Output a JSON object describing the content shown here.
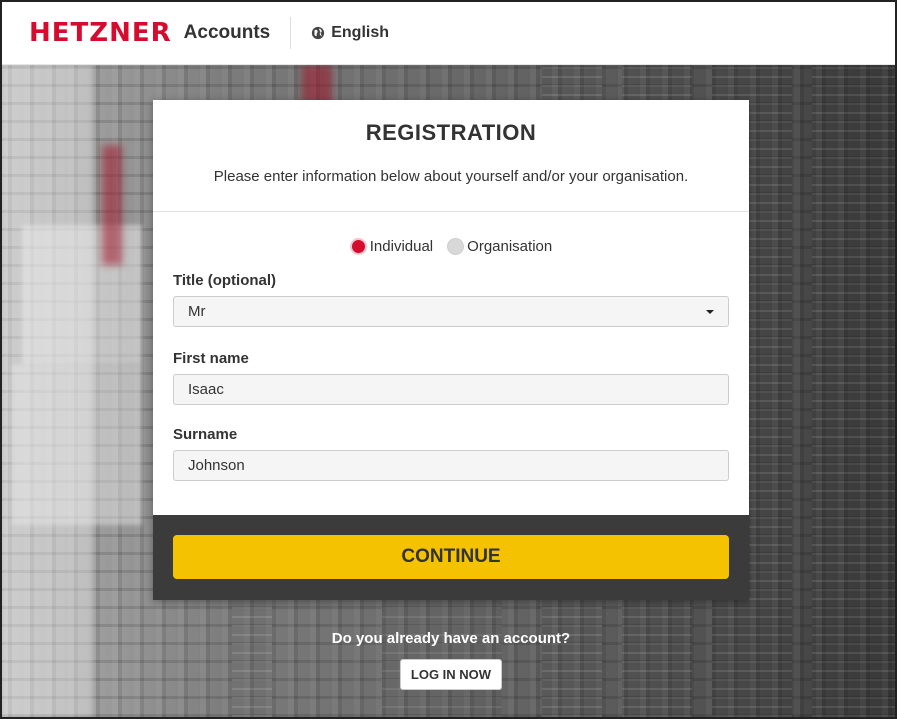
{
  "header": {
    "logo_text": "HETZNER",
    "brand_sub": "Accounts",
    "language": "English",
    "accent_color": "#d50c2d"
  },
  "form": {
    "title": "REGISTRATION",
    "subtitle": "Please enter information below about yourself and/or your organisation.",
    "account_types": [
      "Individual",
      "Organisation"
    ],
    "selected_account_type": "Individual",
    "title_label": "Title (optional)",
    "title_value": "Mr",
    "first_name_label": "First name",
    "first_name_value": "Isaac",
    "surname_label": "Surname",
    "surname_value": "Johnson",
    "continue_label": "CONTINUE",
    "continue_color": "#f5c200"
  },
  "login": {
    "question": "Do you already have an account?",
    "button_label": "LOG IN NOW"
  }
}
